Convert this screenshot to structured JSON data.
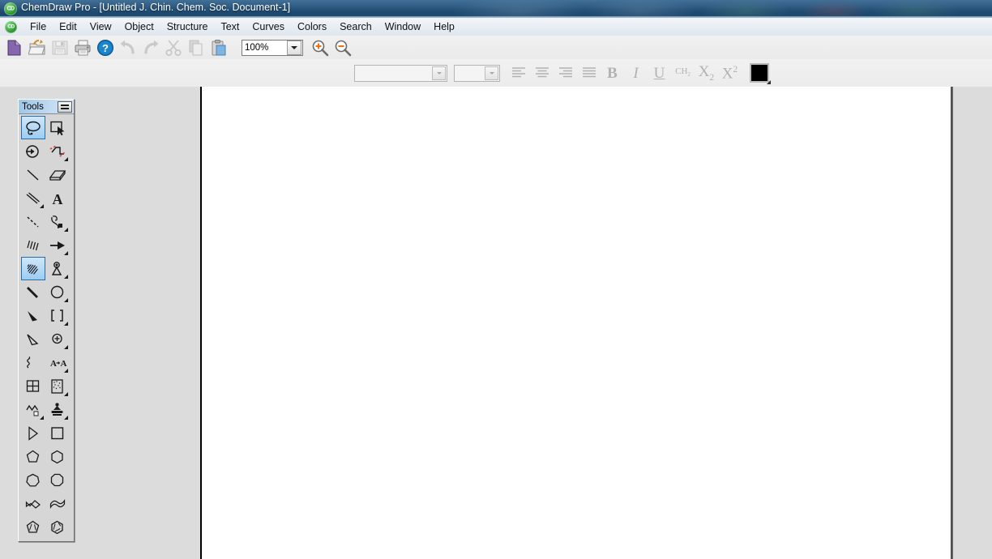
{
  "window": {
    "title": "ChemDraw Pro - [Untitled J. Chin. Chem. Soc. Document-1]",
    "app_icon": "chemdraw-icon"
  },
  "menubar": {
    "icon": "chemdraw-document-icon",
    "items": [
      {
        "label": "File"
      },
      {
        "label": "Edit"
      },
      {
        "label": "View"
      },
      {
        "label": "Object"
      },
      {
        "label": "Structure"
      },
      {
        "label": "Text"
      },
      {
        "label": "Curves"
      },
      {
        "label": "Colors"
      },
      {
        "label": "Search"
      },
      {
        "label": "Window"
      },
      {
        "label": "Help"
      }
    ]
  },
  "toolbar": {
    "buttons": [
      {
        "name": "new-document-button",
        "icon": "new-page-icon",
        "enabled": true
      },
      {
        "name": "open-document-button",
        "icon": "open-folder-icon",
        "enabled": true
      },
      {
        "name": "save-document-button",
        "icon": "floppy-disk-icon",
        "enabled": false
      },
      {
        "name": "print-button",
        "icon": "printer-icon",
        "enabled": true
      },
      {
        "name": "help-button",
        "icon": "question-mark-icon",
        "enabled": true
      },
      {
        "name": "undo-button",
        "icon": "undo-arrow-icon",
        "enabled": false
      },
      {
        "name": "redo-button",
        "icon": "redo-arrow-icon",
        "enabled": false
      },
      {
        "name": "cut-button",
        "icon": "scissors-icon",
        "enabled": false
      },
      {
        "name": "copy-button",
        "icon": "copy-pages-icon",
        "enabled": false
      },
      {
        "name": "paste-button",
        "icon": "clipboard-icon",
        "enabled": true
      }
    ],
    "zoom": {
      "value": "100%",
      "placeholder": "100%",
      "zoom_in_icon": "magnifier-plus-icon",
      "zoom_out_icon": "magnifier-minus-icon"
    }
  },
  "format_toolbar": {
    "font_combo": {
      "value": "",
      "placeholder": ""
    },
    "size_combo": {
      "value": "",
      "placeholder": ""
    },
    "buttons": [
      {
        "name": "align-left-button",
        "icon": "align-left-icon"
      },
      {
        "name": "align-center-button",
        "icon": "align-center-icon"
      },
      {
        "name": "align-right-button",
        "icon": "align-right-icon"
      },
      {
        "name": "align-justify-button",
        "icon": "align-justify-icon"
      }
    ],
    "bold_label": "B",
    "italic_label": "I",
    "underline_label": "U",
    "subscript_formula": "CH",
    "subscript_formula_sub": "2",
    "sub_base": "X",
    "sub_index": "2",
    "sup_base": "X",
    "sup_index": "2",
    "color_swatch": "#000000"
  },
  "tools_palette": {
    "title": "Tools",
    "grip_icon": "drag-grip-icon",
    "items": [
      {
        "name": "lasso-select-tool",
        "icon": "lasso-icon",
        "selected": true,
        "corner": false
      },
      {
        "name": "marquee-select-tool",
        "icon": "marquee-arrow-icon",
        "selected": false,
        "corner": false
      },
      {
        "name": "eraser-tool",
        "icon": "circle-arrow-icon",
        "selected": false,
        "corner": false
      },
      {
        "name": "chain-tool",
        "icon": "dashed-chain-icon",
        "selected": false,
        "corner": true
      },
      {
        "name": "solid-bond-tool",
        "icon": "plain-bond-icon",
        "selected": false,
        "corner": false
      },
      {
        "name": "frame-tool",
        "icon": "box-3d-icon",
        "selected": false,
        "corner": false
      },
      {
        "name": "multiple-bond-tool",
        "icon": "double-bond-icon",
        "selected": false,
        "corner": true
      },
      {
        "name": "text-tool",
        "icon": "letter-a-icon",
        "selected": false,
        "corner": false
      },
      {
        "name": "dashed-bond-tool",
        "icon": "dashed-bond-icon",
        "selected": false,
        "corner": false
      },
      {
        "name": "pen-tool",
        "icon": "fountain-pen-icon",
        "selected": false,
        "corner": true
      },
      {
        "name": "hashed-bond-tool",
        "icon": "hashed-bond-icon",
        "selected": false,
        "corner": false
      },
      {
        "name": "arrow-tool",
        "icon": "arrow-right-icon",
        "selected": false,
        "corner": true
      },
      {
        "name": "bold-hashed-bond-tool",
        "icon": "hashed-wedge-icon",
        "selected": true,
        "corner": false
      },
      {
        "name": "orbital-tool",
        "icon": "orbital-icon",
        "selected": false,
        "corner": true
      },
      {
        "name": "bold-bond-tool",
        "icon": "bold-bond-icon",
        "selected": false,
        "corner": false
      },
      {
        "name": "circle-tool",
        "icon": "circle-shape-icon",
        "selected": false,
        "corner": true
      },
      {
        "name": "wedge-bond-tool",
        "icon": "solid-wedge-icon",
        "selected": false,
        "corner": false
      },
      {
        "name": "bracket-tool",
        "icon": "brackets-icon",
        "selected": false,
        "corner": true
      },
      {
        "name": "hollow-wedge-tool",
        "icon": "hollow-wedge-icon",
        "selected": false,
        "corner": false
      },
      {
        "name": "atom-marker-tool",
        "icon": "circle-plus-icon",
        "selected": false,
        "corner": true
      },
      {
        "name": "squiggle-bond-tool",
        "icon": "squiggle-icon",
        "selected": false,
        "corner": false
      },
      {
        "name": "atom-label-tool",
        "icon": "a-to-a-icon",
        "selected": false,
        "corner": true
      },
      {
        "name": "table-tool",
        "icon": "grid-table-icon",
        "selected": false,
        "corner": false
      },
      {
        "name": "template-tool",
        "icon": "template-page-icon",
        "selected": false,
        "corner": true
      },
      {
        "name": "chain-draw-tool",
        "icon": "zigzag-chain-icon",
        "selected": false,
        "corner": true
      },
      {
        "name": "stamp-tool",
        "icon": "rubber-stamp-icon",
        "selected": false,
        "corner": true
      },
      {
        "name": "triangle-tool",
        "icon": "triangle-shape-icon",
        "selected": false,
        "corner": false
      },
      {
        "name": "rectangle-tool",
        "icon": "square-shape-icon",
        "selected": false,
        "corner": false
      },
      {
        "name": "pentagon-tool",
        "icon": "pentagon-shape-icon",
        "selected": false,
        "corner": false
      },
      {
        "name": "hexagon-tool",
        "icon": "hexagon-shape-icon",
        "selected": false,
        "corner": false
      },
      {
        "name": "heptagon-tool",
        "icon": "heptagon-shape-icon",
        "selected": false,
        "corner": false
      },
      {
        "name": "octagon-tool",
        "icon": "octagon-shape-icon",
        "selected": false,
        "corner": false
      },
      {
        "name": "cyclopentadiene-tool",
        "icon": "ribbon-shape-icon",
        "selected": false,
        "corner": false
      },
      {
        "name": "ribbon-tool",
        "icon": "ribbon-wave-icon",
        "selected": false,
        "corner": false
      },
      {
        "name": "cyclopentane-ring-tool",
        "icon": "cyclopentadiene-ring-icon",
        "selected": false,
        "corner": false
      },
      {
        "name": "benzene-ring-tool",
        "icon": "benzene-ring-icon",
        "selected": false,
        "corner": false
      }
    ]
  },
  "canvas": {
    "background": "#ffffff"
  },
  "colors": {
    "titlebar_start": "#2d5f8b",
    "titlebar_end": "#1d4569",
    "workspace_bg": "#dcdcdc",
    "toolbar_bg": "#f1f1f1",
    "tools_title_accent": "#9fc7e8",
    "selection_blue": "#9ccdf2"
  }
}
